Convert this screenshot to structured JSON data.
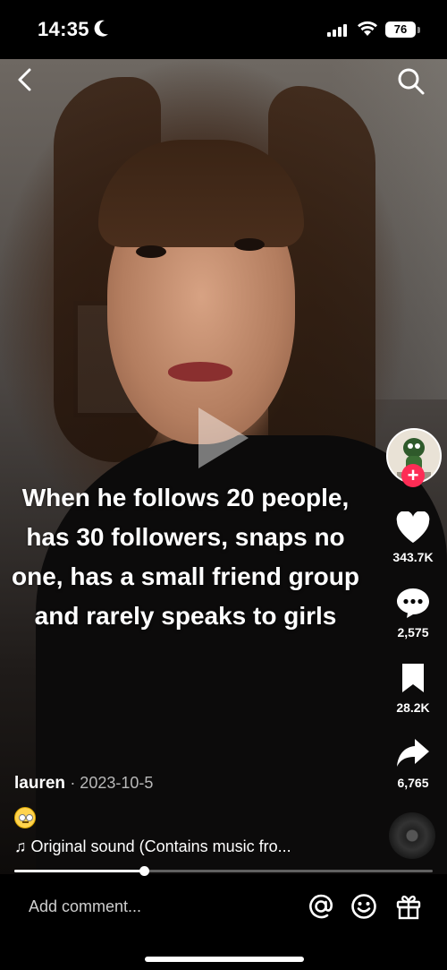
{
  "status_bar": {
    "time": "14:35",
    "battery": "76"
  },
  "video": {
    "caption_overlay": "When he follows 20 people, has 30 followers, snaps no one, has a small friend group and rarely speaks to girls",
    "progress_fraction": 0.31
  },
  "actions": {
    "likes": "343.7K",
    "comments": "2,575",
    "saves": "28.2K",
    "shares": "6,765"
  },
  "post": {
    "author": "lauren",
    "date": "· 2023-10-5",
    "sound": "Original sound (Contains music fro..."
  },
  "comment_bar": {
    "placeholder": "Add comment..."
  }
}
